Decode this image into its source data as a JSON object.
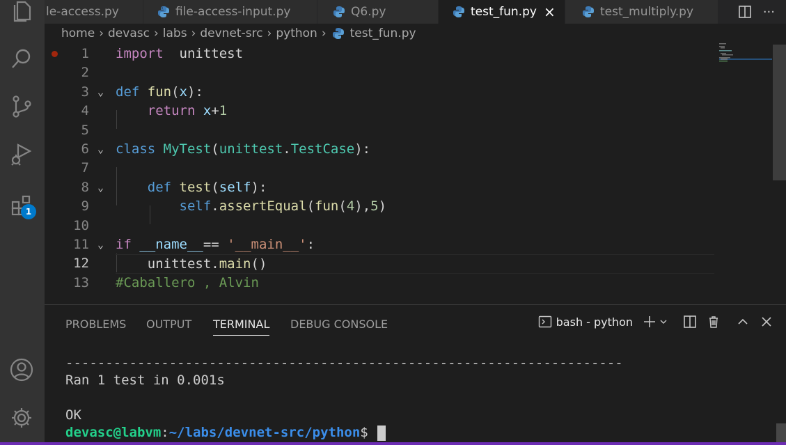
{
  "tabs": [
    {
      "label": "le-access.py",
      "active": false,
      "icon": "python-icon"
    },
    {
      "label": "file-access-input.py",
      "active": false,
      "icon": "python-icon"
    },
    {
      "label": "Q6.py",
      "active": false,
      "icon": "python-icon"
    },
    {
      "label": "test_fun.py",
      "active": true,
      "icon": "python-icon",
      "close": "×"
    },
    {
      "label": "test_multiply.py",
      "active": false,
      "icon": "python-icon"
    }
  ],
  "tab_actions": {
    "split": "split-editor-icon",
    "more": "···"
  },
  "breadcrumb": [
    "home",
    "devasc",
    "labs",
    "devnet-src",
    "python",
    "test_fun.py"
  ],
  "activity_bar": {
    "items": [
      "files-icon",
      "search-icon",
      "source-control-icon",
      "run-debug-icon",
      "extensions-icon"
    ],
    "extensions_badge": "1",
    "bottom": [
      "account-icon",
      "settings-gear-icon"
    ]
  },
  "editor": {
    "line_numbers": [
      "1",
      "2",
      "3",
      "4",
      "5",
      "6",
      "7",
      "8",
      "9",
      "10",
      "11",
      "12",
      "13"
    ],
    "current_line": 12,
    "code": {
      "l1_kw": "import",
      "l1_mod": "unittest",
      "l3_def": "def",
      "l3_fn": "fun",
      "l3_open": "(",
      "l3_arg": "x",
      "l3_close": "):",
      "l4_ret": "return",
      "l4_var": "x",
      "l4_op": "+",
      "l4_num": "1",
      "l6_class": "class",
      "l6_name": "MyTest",
      "l6_open": "(",
      "l6_mod": "unittest",
      "l6_dot": ".",
      "l6_base": "TestCase",
      "l6_close": "):",
      "l8_def": "def",
      "l8_fn": "test",
      "l8_open": "(",
      "l8_self": "self",
      "l8_close": "):",
      "l9_self": "self",
      "l9_dot": ".",
      "l9_fn": "assertEqual",
      "l9_open": "(",
      "l9_fn2": "fun",
      "l9_paren": "(",
      "l9_num1": "4",
      "l9_mid": "),",
      "l9_num2": "5",
      "l9_close": ")",
      "l11_if": "if",
      "l11_name": "__name__",
      "l11_op": "==",
      "l11_str": "'__main__'",
      "l11_colon": ":",
      "l12_mod": "unittest",
      "l12_dot": ".",
      "l12_fn": "main",
      "l12_paren": "()",
      "l13_comment": "#Caballero , Alvin"
    }
  },
  "panel": {
    "tabs": [
      "PROBLEMS",
      "OUTPUT",
      "TERMINAL",
      "DEBUG CONSOLE"
    ],
    "active_tab": "TERMINAL",
    "terminal_name": "bash - python",
    "actions": [
      "new-terminal-icon",
      "chevron-down-icon",
      "split-terminal-icon",
      "trash-icon",
      "chevron-up-icon",
      "close-icon"
    ]
  },
  "terminal": {
    "separator": "----------------------------------------------------------------------",
    "ran": "Ran 1 test in 0.001s",
    "result": "OK",
    "prompt_user": "devasc@labvm",
    "prompt_colon": ":",
    "prompt_path": "~/labs/devnet-src/python",
    "prompt_dollar": "$"
  },
  "colors": {
    "accent": "#007acc",
    "status_bar": "#6c2db3",
    "keyword": "#c586c0",
    "function": "#dcdcaa"
  }
}
